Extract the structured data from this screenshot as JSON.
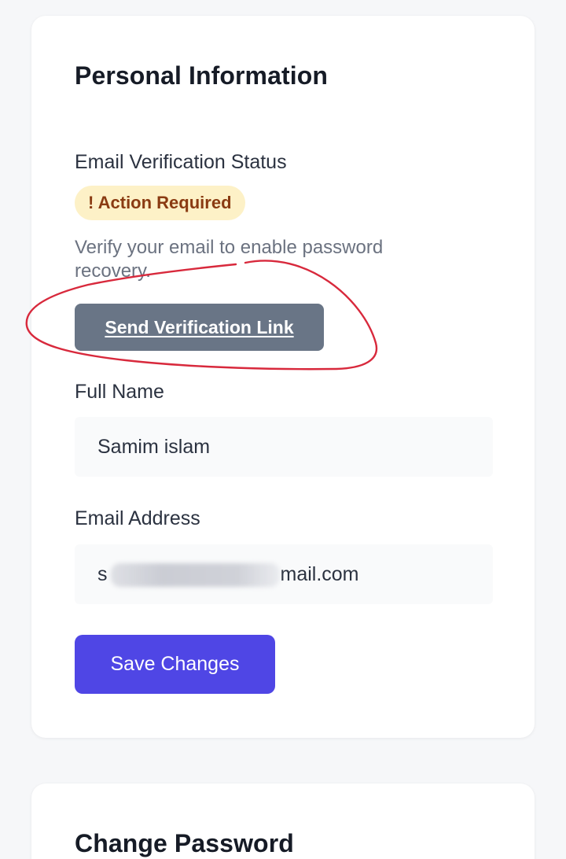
{
  "personal": {
    "title": "Personal Information",
    "verification": {
      "label": "Email Verification Status",
      "badge": "! Action Required",
      "hint": "Verify your email to enable password recovery.",
      "button": "Send Verification Link"
    },
    "full_name": {
      "label": "Full Name",
      "value": "Samim islam"
    },
    "email": {
      "label": "Email Address",
      "value_start": "s",
      "value_end": "mail.com"
    },
    "save_button": "Save Changes"
  },
  "password": {
    "title": "Change Password"
  },
  "colors": {
    "primary": "#4f46e5",
    "secondary_button": "#697586",
    "badge_bg": "#fdf1c7",
    "badge_text": "#8a3b12",
    "annotation": "#d8293c"
  }
}
